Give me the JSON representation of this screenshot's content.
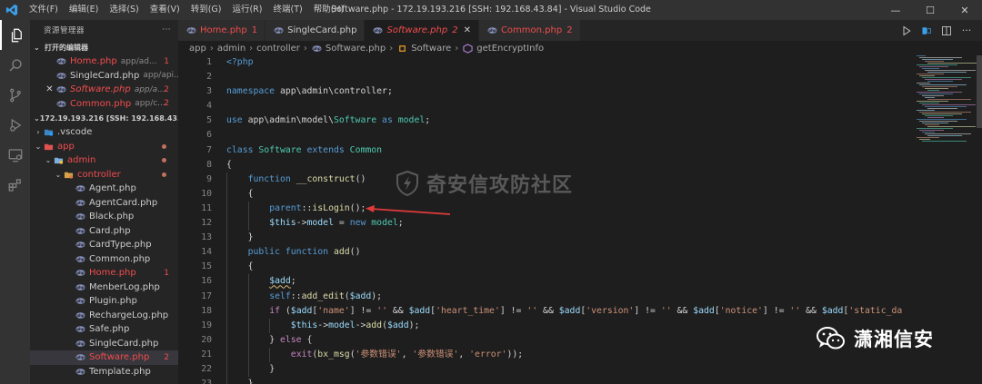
{
  "titlebar": {
    "menu": [
      "文件(F)",
      "编辑(E)",
      "选择(S)",
      "查看(V)",
      "转到(G)",
      "运行(R)",
      "终端(T)",
      "帮助(H)"
    ],
    "title": "Software.php - 172.19.193.216 [SSH: 192.168.43.84] - Visual Studio Code",
    "controls": [
      "—",
      "☐",
      "✕"
    ]
  },
  "sidebar": {
    "header": "资源管理器",
    "more": "···",
    "open_editors_title": "打开的编辑器",
    "open_editors": [
      {
        "name": "Home.php",
        "path": "app/ad...",
        "badge": "1",
        "error": true,
        "italic": false,
        "closable": false
      },
      {
        "name": "SingleCard.php",
        "path": "app/api...",
        "badge": "",
        "error": false,
        "italic": false,
        "closable": false
      },
      {
        "name": "Software.php",
        "path": "app/a...",
        "badge": "2",
        "error": true,
        "italic": true,
        "closable": true
      },
      {
        "name": "Common.php",
        "path": "app/c...",
        "badge": "2",
        "error": true,
        "italic": false,
        "closable": false
      }
    ],
    "workspace_title": "172.19.193.216 [SSH: 192.168.43.84]",
    "tree": [
      {
        "name": ".vscode",
        "type": "folder-vscode",
        "level": 1,
        "chev": "›",
        "error": false,
        "badge": "",
        "dot": false
      },
      {
        "name": "app",
        "type": "folder-app",
        "level": 1,
        "chev": "⌄",
        "error": true,
        "badge": "",
        "dot": true
      },
      {
        "name": "admin",
        "type": "folder-admin",
        "level": 2,
        "chev": "⌄",
        "error": true,
        "badge": "",
        "dot": true
      },
      {
        "name": "controller",
        "type": "folder-controller",
        "level": 3,
        "chev": "⌄",
        "error": true,
        "badge": "",
        "dot": true
      },
      {
        "name": "Agent.php",
        "type": "php",
        "level": 4,
        "chev": "",
        "error": false,
        "badge": "",
        "dot": false
      },
      {
        "name": "AgentCard.php",
        "type": "php",
        "level": 4,
        "chev": "",
        "error": false,
        "badge": "",
        "dot": false
      },
      {
        "name": "Black.php",
        "type": "php",
        "level": 4,
        "chev": "",
        "error": false,
        "badge": "",
        "dot": false
      },
      {
        "name": "Card.php",
        "type": "php",
        "level": 4,
        "chev": "",
        "error": false,
        "badge": "",
        "dot": false
      },
      {
        "name": "CardType.php",
        "type": "php",
        "level": 4,
        "chev": "",
        "error": false,
        "badge": "",
        "dot": false
      },
      {
        "name": "Common.php",
        "type": "php",
        "level": 4,
        "chev": "",
        "error": false,
        "badge": "",
        "dot": false
      },
      {
        "name": "Home.php",
        "type": "php",
        "level": 4,
        "chev": "",
        "error": true,
        "badge": "1",
        "dot": false
      },
      {
        "name": "MenberLog.php",
        "type": "php",
        "level": 4,
        "chev": "",
        "error": false,
        "badge": "",
        "dot": false
      },
      {
        "name": "Plugin.php",
        "type": "php",
        "level": 4,
        "chev": "",
        "error": false,
        "badge": "",
        "dot": false
      },
      {
        "name": "RechargeLog.php",
        "type": "php",
        "level": 4,
        "chev": "",
        "error": false,
        "badge": "",
        "dot": false
      },
      {
        "name": "Safe.php",
        "type": "php",
        "level": 4,
        "chev": "",
        "error": false,
        "badge": "",
        "dot": false
      },
      {
        "name": "SingleCard.php",
        "type": "php",
        "level": 4,
        "chev": "",
        "error": false,
        "badge": "",
        "dot": false
      },
      {
        "name": "Software.php",
        "type": "php",
        "level": 4,
        "chev": "",
        "error": true,
        "badge": "2",
        "dot": false,
        "selected": true
      },
      {
        "name": "Template.php",
        "type": "php",
        "level": 4,
        "chev": "",
        "error": false,
        "badge": "",
        "dot": false
      }
    ]
  },
  "tabs": [
    {
      "name": "Home.php",
      "num": "1",
      "error": true,
      "active": false,
      "italic": false,
      "close": ""
    },
    {
      "name": "SingleCard.php",
      "num": "",
      "error": false,
      "active": false,
      "italic": false,
      "close": ""
    },
    {
      "name": "Software.php",
      "num": "2",
      "error": true,
      "active": true,
      "italic": true,
      "close": "✕"
    },
    {
      "name": "Common.php",
      "num": "2",
      "error": true,
      "active": false,
      "italic": false,
      "close": ""
    }
  ],
  "breadcrumbs": [
    "app",
    "admin",
    "controller",
    "Software.php",
    "Software",
    "getEncryptInfo"
  ],
  "code": [
    {
      "n": "1",
      "indent": 0,
      "tokens": [
        [
          "k",
          "<?php"
        ]
      ]
    },
    {
      "n": "2",
      "indent": 0,
      "tokens": []
    },
    {
      "n": "3",
      "indent": 0,
      "tokens": [
        [
          "k",
          "namespace "
        ],
        [
          "p",
          "app\\admin\\controller;"
        ]
      ]
    },
    {
      "n": "4",
      "indent": 0,
      "tokens": []
    },
    {
      "n": "5",
      "indent": 0,
      "tokens": [
        [
          "k",
          "use "
        ],
        [
          "p",
          "app\\admin\\model\\"
        ],
        [
          "t",
          "Software"
        ],
        [
          "k",
          " as "
        ],
        [
          "t",
          "model"
        ],
        [
          "p",
          ";"
        ]
      ]
    },
    {
      "n": "6",
      "indent": 0,
      "tokens": []
    },
    {
      "n": "7",
      "indent": 0,
      "tokens": [
        [
          "k",
          "class "
        ],
        [
          "t",
          "Software"
        ],
        [
          "k",
          " extends "
        ],
        [
          "t",
          "Common"
        ]
      ]
    },
    {
      "n": "8",
      "indent": 0,
      "tokens": [
        [
          "p",
          "{"
        ]
      ]
    },
    {
      "n": "9",
      "indent": 1,
      "tokens": [
        [
          "k",
          "function "
        ],
        [
          "f",
          "__construct"
        ],
        [
          "p",
          "()"
        ]
      ]
    },
    {
      "n": "10",
      "indent": 1,
      "tokens": [
        [
          "p",
          "{"
        ]
      ]
    },
    {
      "n": "11",
      "indent": 2,
      "tokens": [
        [
          "k",
          "parent"
        ],
        [
          "p",
          "::"
        ],
        [
          "f",
          "isLogin"
        ],
        [
          "p",
          "();"
        ]
      ]
    },
    {
      "n": "12",
      "indent": 2,
      "tokens": [
        [
          "v",
          "$this"
        ],
        [
          "p",
          "->"
        ],
        [
          "v",
          "model"
        ],
        [
          "p",
          " = "
        ],
        [
          "k",
          "new "
        ],
        [
          "t",
          "model"
        ],
        [
          "p",
          ";"
        ]
      ]
    },
    {
      "n": "13",
      "indent": 1,
      "tokens": [
        [
          "p",
          "}"
        ]
      ]
    },
    {
      "n": "14",
      "indent": 1,
      "tokens": [
        [
          "k",
          "public function "
        ],
        [
          "f",
          "add"
        ],
        [
          "p",
          "()"
        ]
      ]
    },
    {
      "n": "15",
      "indent": 1,
      "tokens": [
        [
          "p",
          "{"
        ]
      ]
    },
    {
      "n": "16",
      "indent": 2,
      "tokens": [
        [
          "v sq",
          "$add"
        ],
        [
          "p",
          ";"
        ]
      ]
    },
    {
      "n": "17",
      "indent": 2,
      "tokens": [
        [
          "k",
          "self"
        ],
        [
          "p",
          "::"
        ],
        [
          "f",
          "add_edit"
        ],
        [
          "p",
          "("
        ],
        [
          "v",
          "$add"
        ],
        [
          "p",
          ");"
        ]
      ]
    },
    {
      "n": "18",
      "indent": 2,
      "tokens": [
        [
          "c",
          "if "
        ],
        [
          "p",
          "("
        ],
        [
          "v",
          "$add"
        ],
        [
          "p",
          "["
        ],
        [
          "s",
          "'name'"
        ],
        [
          "p",
          "] != "
        ],
        [
          "s",
          "''"
        ],
        [
          "p",
          " && "
        ],
        [
          "v",
          "$add"
        ],
        [
          "p",
          "["
        ],
        [
          "s",
          "'heart_time'"
        ],
        [
          "p",
          "] != "
        ],
        [
          "s",
          "''"
        ],
        [
          "p",
          " && "
        ],
        [
          "v",
          "$add"
        ],
        [
          "p",
          "["
        ],
        [
          "s",
          "'version'"
        ],
        [
          "p",
          "] != "
        ],
        [
          "s",
          "''"
        ],
        [
          "p",
          " && "
        ],
        [
          "v",
          "$add"
        ],
        [
          "p",
          "["
        ],
        [
          "s",
          "'notice'"
        ],
        [
          "p",
          "] != "
        ],
        [
          "s",
          "''"
        ],
        [
          "p",
          " && "
        ],
        [
          "v",
          "$add"
        ],
        [
          "p",
          "["
        ],
        [
          "s",
          "'static_da"
        ]
      ]
    },
    {
      "n": "19",
      "indent": 3,
      "tokens": [
        [
          "v",
          "$this"
        ],
        [
          "p",
          "->"
        ],
        [
          "v",
          "model"
        ],
        [
          "p",
          "->"
        ],
        [
          "f",
          "add"
        ],
        [
          "p",
          "("
        ],
        [
          "v",
          "$add"
        ],
        [
          "p",
          ");"
        ]
      ]
    },
    {
      "n": "20",
      "indent": 2,
      "tokens": [
        [
          "p",
          "} "
        ],
        [
          "c",
          "else"
        ],
        [
          "p",
          " {"
        ]
      ]
    },
    {
      "n": "21",
      "indent": 3,
      "tokens": [
        [
          "c",
          "exit"
        ],
        [
          "p",
          "("
        ],
        [
          "f",
          "bx_msg"
        ],
        [
          "p",
          "("
        ],
        [
          "s",
          "'参数错误'"
        ],
        [
          "p",
          ", "
        ],
        [
          "s",
          "'参数错误'"
        ],
        [
          "p",
          ", "
        ],
        [
          "s",
          "'error'"
        ],
        [
          "p",
          "));"
        ]
      ]
    },
    {
      "n": "22",
      "indent": 2,
      "tokens": [
        [
          "p",
          "}"
        ]
      ]
    },
    {
      "n": "23",
      "indent": 1,
      "tokens": [
        [
          "p",
          "}"
        ]
      ]
    }
  ],
  "watermark_center": "奇安信攻防社区",
  "watermark_right": "潇湘信安",
  "colors": {
    "accent": "#007acc",
    "error": "#f14c4c",
    "arrow": "#e03a3a"
  }
}
